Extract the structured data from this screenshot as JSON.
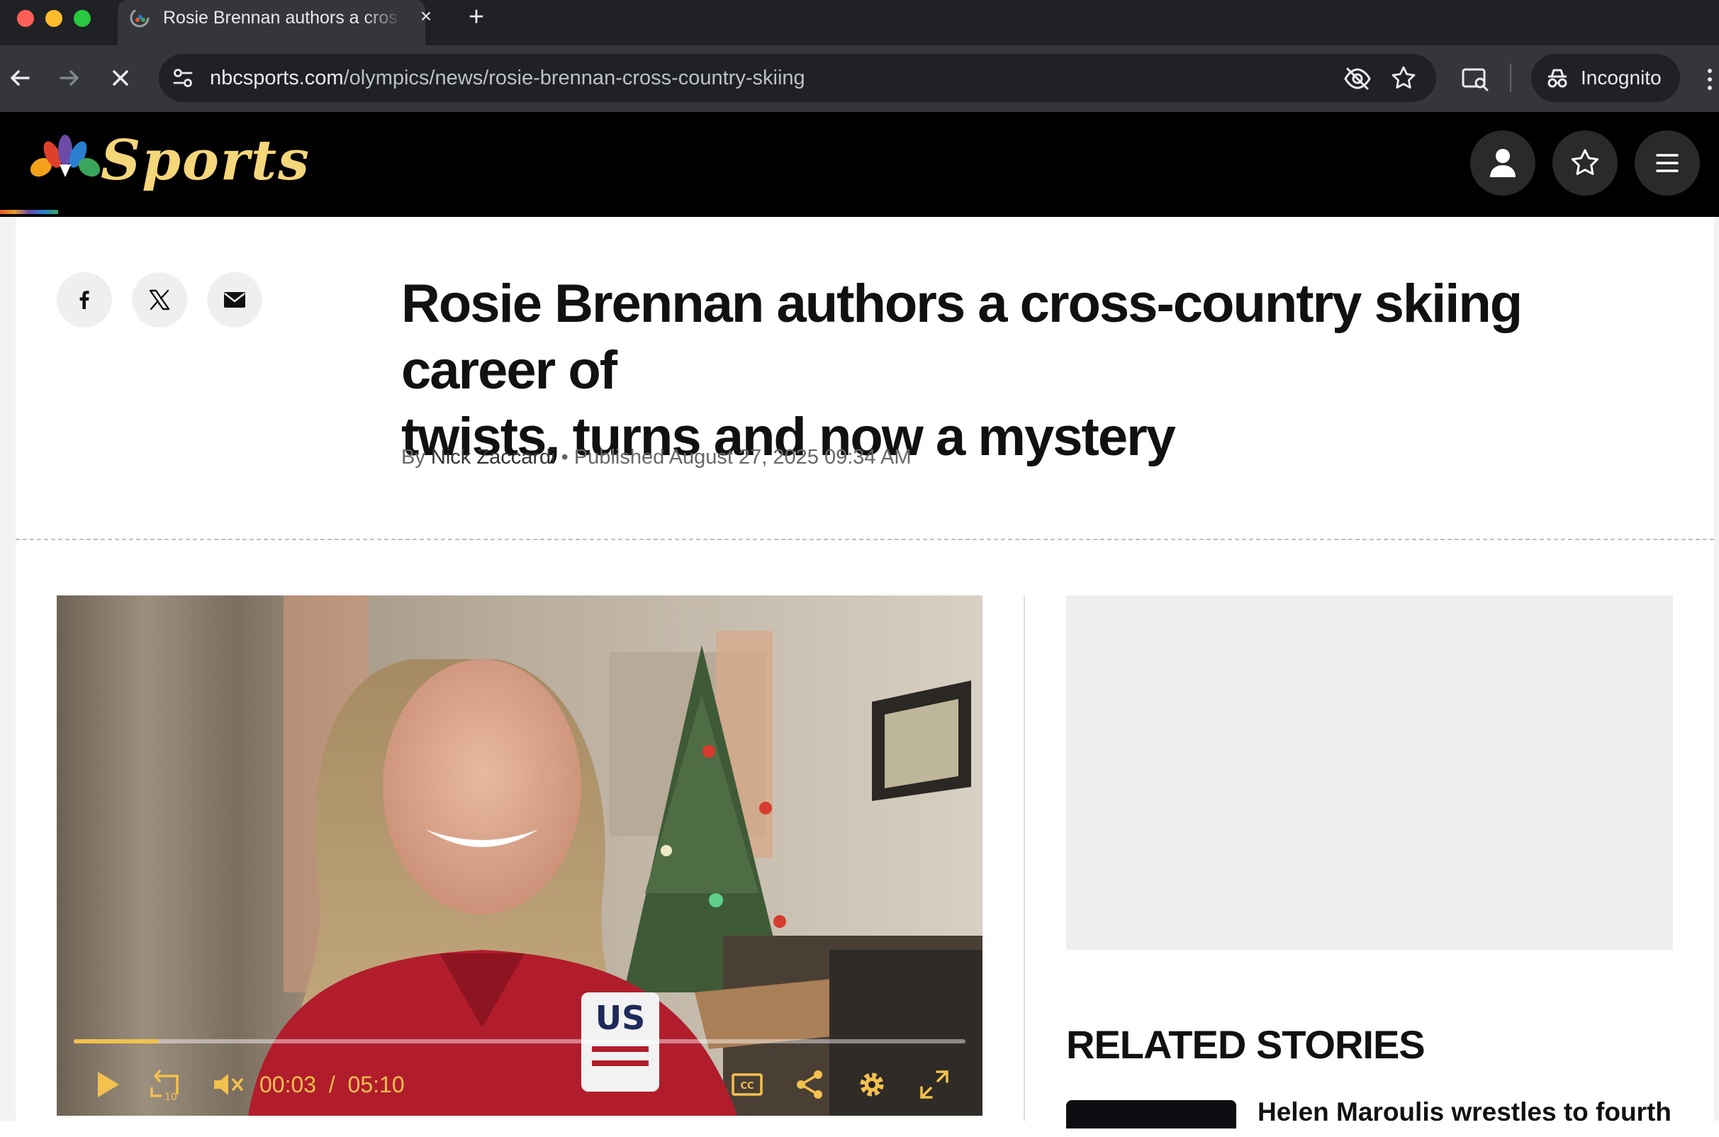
{
  "browser": {
    "tab_title": "Rosie Brennan authors a cross-country skiing career of twists, turns and now a mystery",
    "tab_close": "×",
    "new_tab": "+",
    "url_domain": "nbcsports.com",
    "url_path": "/olympics/news/rosie-brennan-cross-country-skiing",
    "incognito_label": "Incognito"
  },
  "site": {
    "logo_text": "Sports"
  },
  "article": {
    "headline_line1": "Rosie Brennan authors a cross-country skiing career of",
    "headline_line2": "twists, turns and now a mystery",
    "byline_prefix": "By ",
    "author": "Nick Zaccardi",
    "byline_sep": " • ",
    "published": "Published August 27, 2025 09:34 AM"
  },
  "video": {
    "current_time": "00:03",
    "time_separator": "/",
    "duration": "05:10",
    "progress_fraction": 0.0097,
    "rewind_seconds": "10",
    "cc_label": "CC",
    "accent_color": "#f2c14e"
  },
  "sidebar": {
    "related_heading": "RELATED STORIES",
    "related_items": [
      {
        "title": "Helen Maroulis wrestles to fourth"
      }
    ]
  },
  "colors": {
    "header_bg": "#000000",
    "logo_gold": "#f5d67a"
  }
}
